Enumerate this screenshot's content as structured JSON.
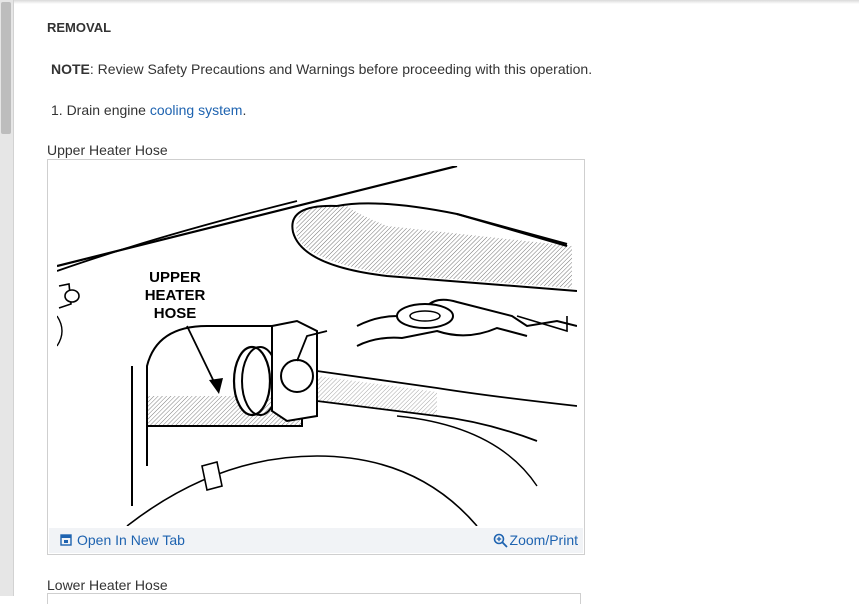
{
  "section": {
    "heading": "REMOVAL"
  },
  "note": {
    "label": "NOTE",
    "text": ": Review Safety Precautions and Warnings before proceeding with this operation."
  },
  "steps": [
    {
      "prefix": "1. Drain engine ",
      "link": "cooling system",
      "suffix": "."
    }
  ],
  "figures": [
    {
      "caption": "Upper Heater Hose",
      "callout": [
        "UPPER",
        "HEATER",
        "HOSE"
      ],
      "open_label": "Open In New Tab",
      "zoom_label": "Zoom/Print",
      "open_icon": "open-in-new-tab-icon",
      "zoom_icon": "magnifier-plus-icon"
    },
    {
      "caption": "Lower Heater Hose"
    }
  ],
  "colors": {
    "link": "#1e63b0",
    "text": "#333333",
    "figure_bar": "#f1f3f6"
  }
}
